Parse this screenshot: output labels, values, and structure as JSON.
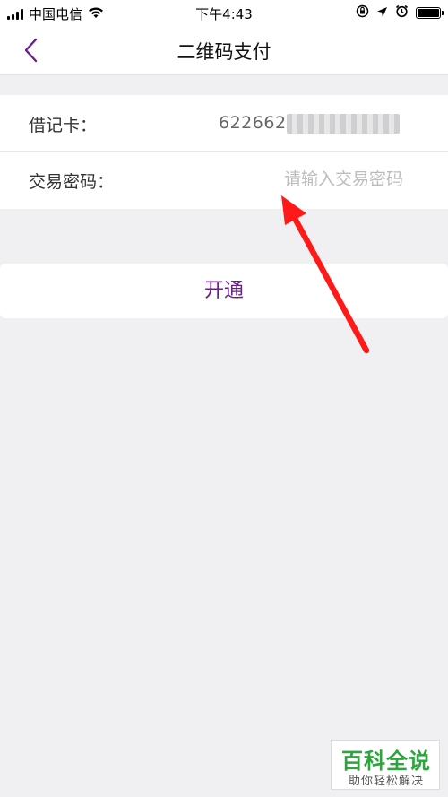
{
  "status_bar": {
    "carrier": "中国电信",
    "time": "下午4:43"
  },
  "nav": {
    "title": "二维码支付"
  },
  "form": {
    "card_label": "借记卡：",
    "card_number": "622662",
    "password_label": "交易密码：",
    "password_placeholder": "请输入交易密码",
    "password_value": ""
  },
  "actions": {
    "open_label": "开通"
  },
  "watermark": {
    "main": "百科全说",
    "sub": "助你轻松解决"
  },
  "colors": {
    "accent": "#6a1f8a",
    "background": "#f0f0f2",
    "annotation_arrow": "#ff1a1a",
    "watermark_green": "#2aa63a"
  },
  "icons": [
    "signal-icon",
    "wifi-icon",
    "rotation-lock-icon",
    "location-icon",
    "alarm-icon",
    "battery-icon",
    "back-chevron-icon"
  ]
}
